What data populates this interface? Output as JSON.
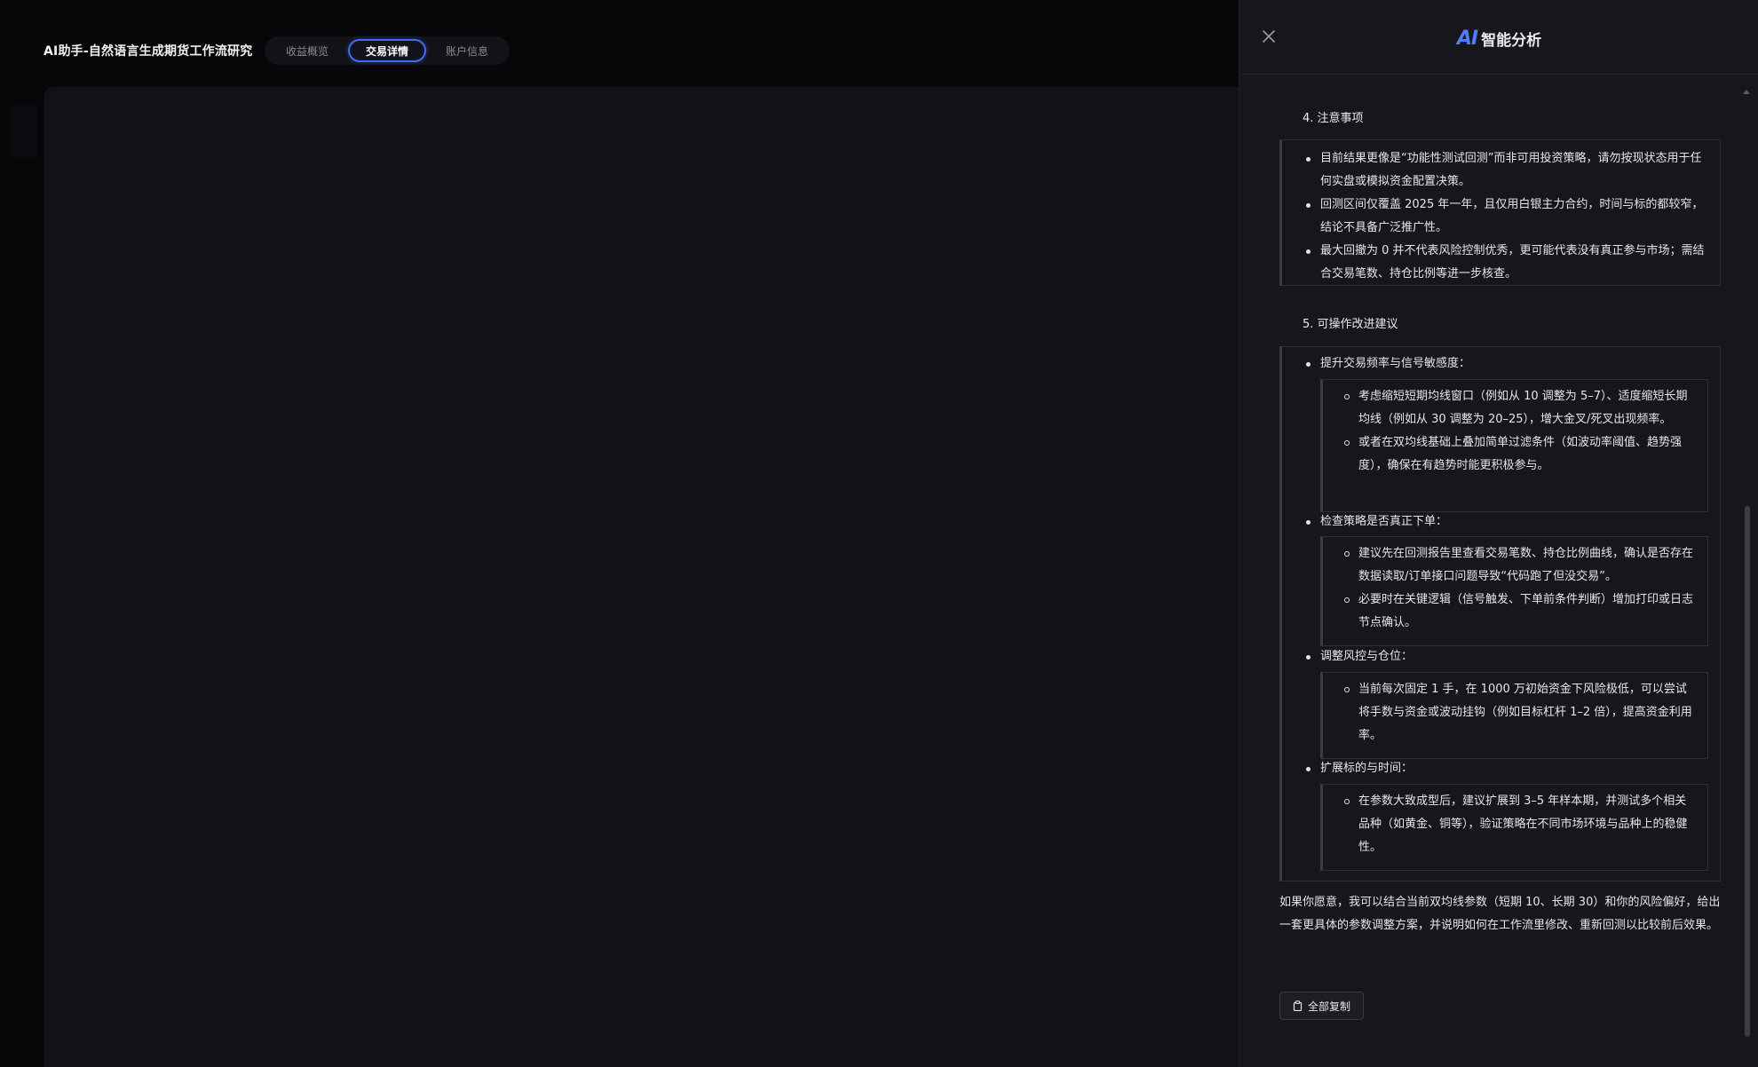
{
  "app": {
    "title": "AI助手-自然语言生成期货工作流研究",
    "tabs": [
      {
        "label": "收益概览",
        "active": false
      },
      {
        "label": "交易详情",
        "active": true
      },
      {
        "label": "账户信息",
        "active": false
      }
    ]
  },
  "drawer": {
    "logo": "AI",
    "title": "智能分析",
    "close_icon": "close-icon",
    "accent_color": "#4f7bff",
    "sections": {
      "s4": {
        "heading": "4. 注意事项",
        "items": [
          "目前结果更像是“功能性测试回测”而非可用投资策略，请勿按现状态用于任何实盘或模拟资金配置决策。",
          "回测区间仅覆盖 2025 年一年，且仅用白银主力合约，时间与标的都较窄，结论不具备广泛推广性。",
          "最大回撤为 0 并不代表风险控制优秀，更可能代表没有真正参与市场；需结合交易笔数、持仓比例等进一步核查。"
        ]
      },
      "s5": {
        "heading": "5. 可操作改进建议",
        "groups": [
          {
            "label": "提升交易频率与信号敏感度：",
            "subs": [
              "考虑缩短短期均线窗口（例如从 10 调整为 5–7）、适度缩短长期均线（例如从 30 调整为 20–25），增大金叉/死叉出现频率。",
              "或者在双均线基础上叠加简单过滤条件（如波动率阈值、趋势强度），确保在有趋势时能更积极参与。"
            ]
          },
          {
            "label": "检查策略是否真正下单：",
            "subs": [
              "建议先在回测报告里查看交易笔数、持仓比例曲线，确认是否存在数据读取/订单接口问题导致“代码跑了但没交易”。",
              "必要时在关键逻辑（信号触发、下单前条件判断）增加打印或日志节点确认。"
            ]
          },
          {
            "label": "调整风控与仓位：",
            "subs": [
              "当前每次固定 1 手，在 1000 万初始资金下风险极低，可以尝试将手数与资金或波动挂钩（例如目标杠杆 1–2 倍），提高资金利用率。"
            ]
          },
          {
            "label": "扩展标的与时间：",
            "subs": [
              "在参数大致成型后，建议扩展到 3–5 年样本期，并测试多个相关品种（如黄金、铜等），验证策略在不同市场环境与品种上的稳健性。"
            ]
          }
        ]
      }
    },
    "closing": "如果你愿意，我可以结合当前双均线参数（短期 10、长期 30）和你的风险偏好，给出一套更具体的参数调整方案，并说明如何在工作流里修改、重新回测以比较前后效果。",
    "copy_button": {
      "label": "全部复制",
      "icon": "clipboard-icon"
    }
  }
}
